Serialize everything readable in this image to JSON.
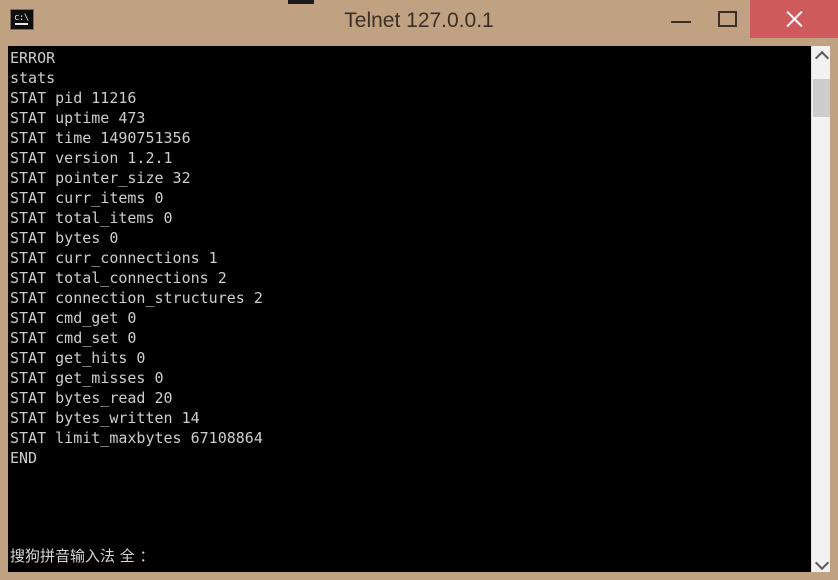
{
  "window": {
    "title": "Telnet 127.0.0.1",
    "app_icon": "console-terminal-icon",
    "titlebar_color": "#c0a182",
    "close_button_color": "#cf5a5c",
    "controls": {
      "minimize_label": "–",
      "maximize_label": "□",
      "close_label": "×"
    }
  },
  "console": {
    "background": "#000000",
    "text_color": "#cdcdcd",
    "lines": [
      "ERROR",
      "stats",
      "STAT pid 11216",
      "STAT uptime 473",
      "STAT time 1490751356",
      "STAT version 1.2.1",
      "STAT pointer_size 32",
      "STAT curr_items 0",
      "STAT total_items 0",
      "STAT bytes 0",
      "STAT curr_connections 1",
      "STAT total_connections 2",
      "STAT connection_structures 2",
      "STAT cmd_get 0",
      "STAT cmd_set 0",
      "STAT get_hits 0",
      "STAT get_misses 0",
      "STAT bytes_read 20",
      "STAT bytes_written 14",
      "STAT limit_maxbytes 67108864",
      "END"
    ],
    "ime_status": "搜狗拼音输入法 全 ："
  },
  "scrollbar": {
    "up_arrow": "chevron-up-icon",
    "down_arrow": "chevron-down-icon",
    "thumb_color": "#cdcdcd",
    "track_color": "#f2f2f2"
  }
}
